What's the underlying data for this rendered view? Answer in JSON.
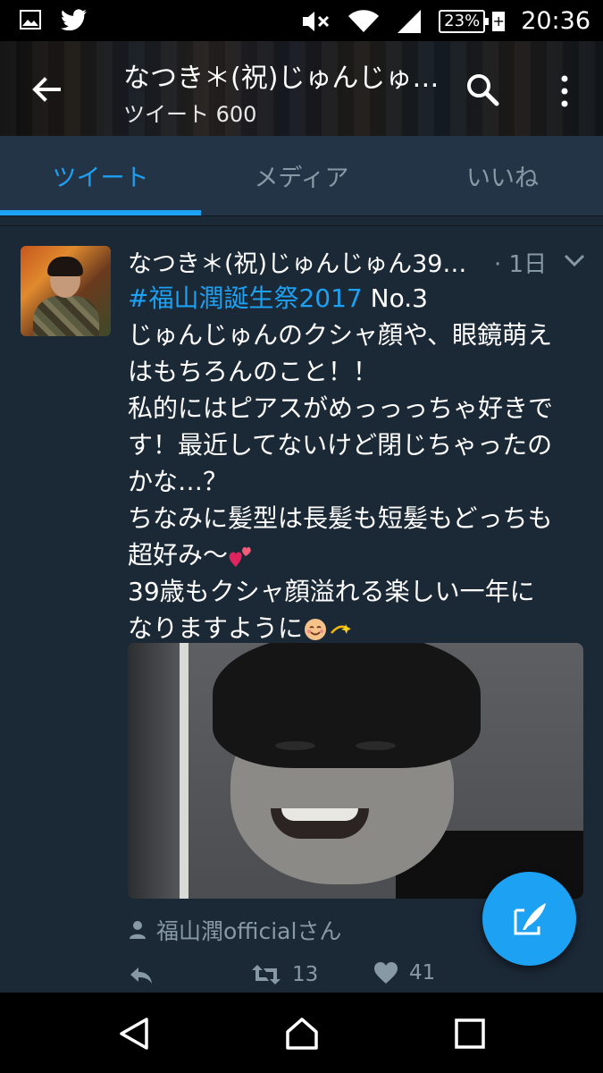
{
  "status_bar": {
    "left_icons": [
      "image-icon",
      "twitter-bird-icon"
    ],
    "right_icons": [
      "mute-icon",
      "wifi-icon",
      "signal-icon"
    ],
    "battery": "23%",
    "battery_charging": "+",
    "time": "20:36"
  },
  "header": {
    "title": "なつき＊(祝)じゅんじゅ…",
    "subtitle": "ツイート 600",
    "back_icon": "arrow-left-icon",
    "search_icon": "search-icon",
    "more_icon": "more-vertical-icon"
  },
  "tabs": [
    {
      "label": "ツイート",
      "active": true
    },
    {
      "label": "メディア",
      "active": false
    },
    {
      "label": "いいね",
      "active": false
    }
  ],
  "tweet": {
    "author": "なつき＊(祝)じゅんじゅん39…",
    "time": "· 1日",
    "lines": [
      {
        "hashtag": "#福山潤誕生祭2017",
        "text": " No.3"
      },
      {
        "text": "じゅんじゅんのクシャ顔や、眼鏡萌え"
      },
      {
        "text": "はもちろんのこと！！"
      },
      {
        "text": "私的にはピアスがめっっっちゃ好きで"
      },
      {
        "text": "す！最近してないけど閉じちゃったの"
      },
      {
        "text": "かな…？"
      },
      {
        "text": "ちなみに髪型は長髪も短髪もどっちも"
      },
      {
        "text": "超好み〜"
      },
      {
        "text": "39歳もクシャ顔溢れる楽しい一年に"
      },
      {
        "text": "なりますように"
      }
    ],
    "emojis": [
      "two-hearts-emoji",
      "smiling-face-emoji",
      "dizzy-emoji"
    ],
    "tagged": "福山潤officialさん",
    "retweets": "13",
    "likes": "41"
  },
  "colors": {
    "background": "#1b2836",
    "tab_bar": "#243447",
    "accent": "#1da1f2",
    "muted": "#8899a6"
  }
}
